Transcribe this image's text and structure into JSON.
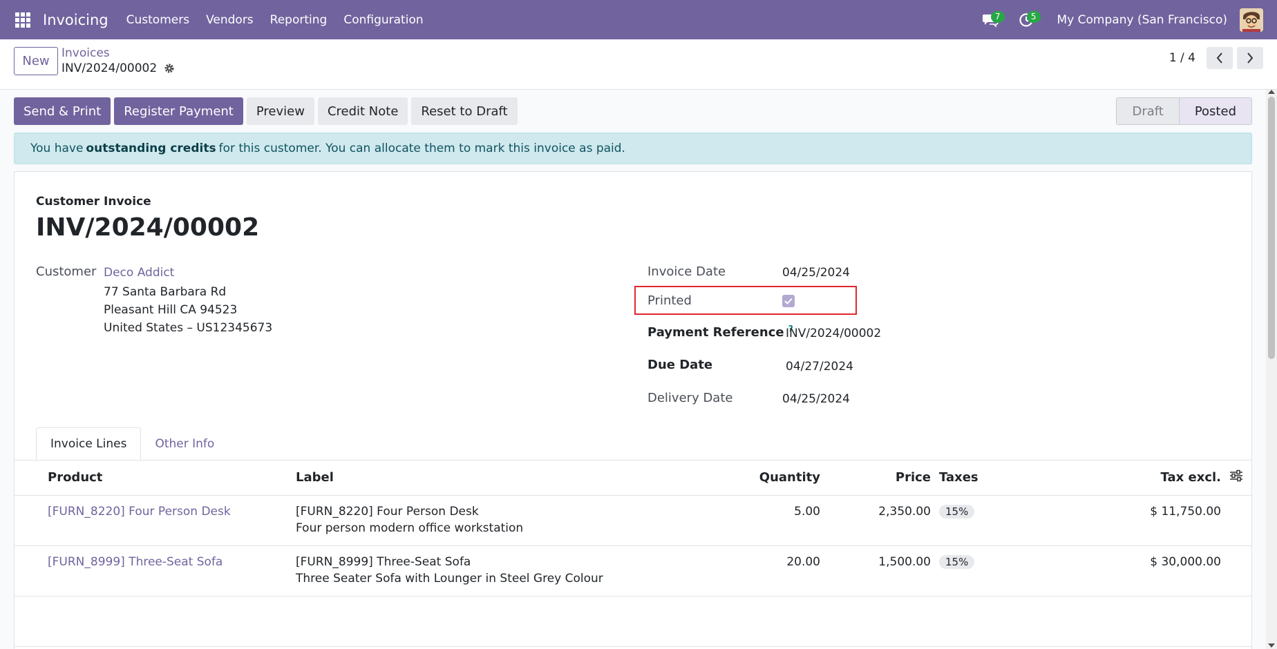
{
  "navbar": {
    "app_name": "Invoicing",
    "menu": [
      "Customers",
      "Vendors",
      "Reporting",
      "Configuration"
    ],
    "messages_count": "7",
    "activities_count": "5",
    "company": "My Company (San Francisco)"
  },
  "control_panel": {
    "new_label": "New",
    "breadcrumb": "Invoices",
    "record_name": "INV/2024/00002",
    "pager_value": "1 / 4"
  },
  "actions": {
    "send_print": "Send & Print",
    "register_payment": "Register Payment",
    "preview": "Preview",
    "credit_note": "Credit Note",
    "reset_to_draft": "Reset to Draft"
  },
  "statusbar": {
    "draft": "Draft",
    "posted": "Posted"
  },
  "alert": {
    "prefix": "You have",
    "highlight": "outstanding credits",
    "suffix": "for this customer. You can allocate them to mark this invoice as paid."
  },
  "form": {
    "subtitle": "Customer Invoice",
    "title": "INV/2024/00002",
    "customer_label": "Customer",
    "customer_name": "Deco Addict",
    "address": [
      "77 Santa Barbara Rd",
      "Pleasant Hill CA 94523",
      "United States – US12345673"
    ],
    "invoice_date_label": "Invoice Date",
    "invoice_date": "04/25/2024",
    "printed_label": "Printed",
    "printed": true,
    "payment_ref_label": "Payment Reference",
    "payment_ref_help": "?",
    "payment_ref": "INV/2024/00002",
    "due_date_label": "Due Date",
    "due_date": "04/27/2024",
    "delivery_date_label": "Delivery Date",
    "delivery_date": "04/25/2024"
  },
  "tabs": {
    "invoice_lines": "Invoice Lines",
    "other_info": "Other Info"
  },
  "lines": {
    "headers": {
      "product": "Product",
      "label": "Label",
      "quantity": "Quantity",
      "price": "Price",
      "taxes": "Taxes",
      "tax_excl": "Tax excl."
    },
    "rows": [
      {
        "product": "[FURN_8220] Four Person Desk",
        "label": "[FURN_8220] Four Person Desk",
        "description": "Four person modern office workstation",
        "quantity": "5.00",
        "price": "2,350.00",
        "tax": "15%",
        "subtotal": "$ 11,750.00"
      },
      {
        "product": "[FURN_8999] Three-Seat Sofa",
        "label": "[FURN_8999] Three-Seat Sofa",
        "description": "Three Seater Sofa with Lounger in Steel Grey Colour",
        "quantity": "20.00",
        "price": "1,500.00",
        "tax": "15%",
        "subtotal": "$ 30,000.00"
      }
    ]
  },
  "colors": {
    "primary": "#71639e",
    "alert_bg": "#cfe9ee",
    "highlight_border": "#e0262b"
  }
}
